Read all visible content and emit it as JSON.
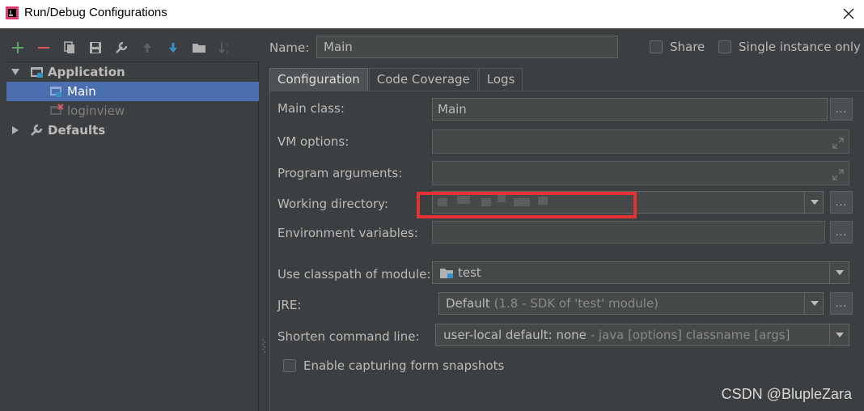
{
  "window": {
    "title": "Run/Debug Configurations"
  },
  "tree": {
    "application_label": "Application",
    "main_label": "Main",
    "loginview_label": "loginview",
    "defaults_label": "Defaults"
  },
  "form": {
    "name_label": "Name:",
    "name_value": "Main",
    "share_label": "Share",
    "single_instance_label": "Single instance only",
    "tabs": [
      "Configuration",
      "Code Coverage",
      "Logs"
    ],
    "main_class_label": "Main class:",
    "main_class_value": "Main",
    "vm_options_label": "VM options:",
    "program_args_label": "Program arguments:",
    "working_dir_label": "Working directory:",
    "env_vars_label": "Environment variables:",
    "classpath_label": "Use classpath of module:",
    "classpath_value": "test",
    "jre_label": "JRE:",
    "jre_value": "Default",
    "jre_detail": "(1.8 - SDK of 'test' module)",
    "shorten_label": "Shorten command line:",
    "shorten_value": "user-local default: none",
    "shorten_detail": "- java [options] classname [args]",
    "snapshots_label": "Enable capturing form snapshots",
    "dots": "..."
  },
  "watermark": "CSDN @BlupleZara",
  "colors": {
    "selection": "#4b6eaf",
    "highlight": "#e53333",
    "add": "#59a869",
    "remove": "#db5860"
  }
}
